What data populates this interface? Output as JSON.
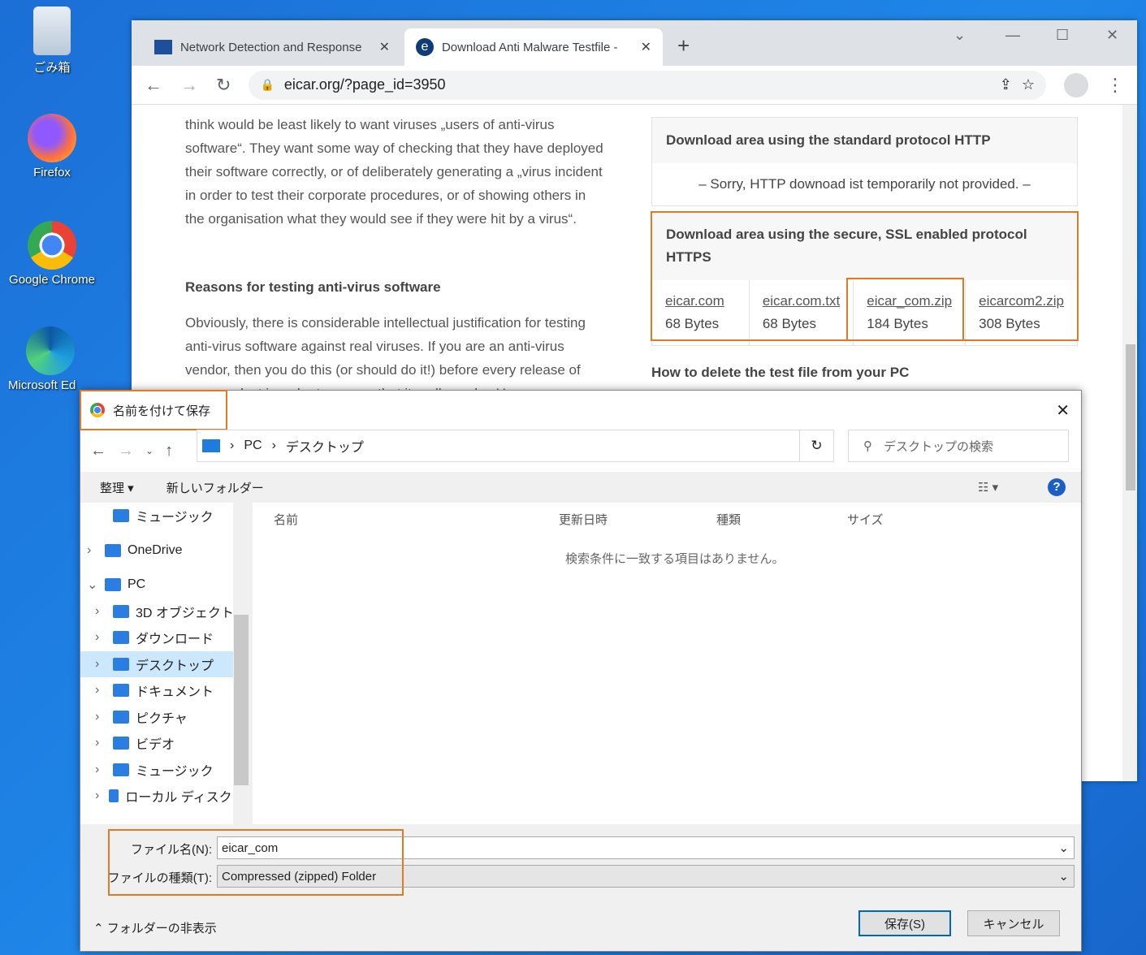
{
  "desktop": {
    "icons": [
      {
        "label": "ごみ箱",
        "icon": "recycle-bin-icon"
      },
      {
        "label": "Firefox",
        "icon": "firefox-icon"
      },
      {
        "label": "Google Chrome",
        "icon": "chrome-icon"
      },
      {
        "label": "Microsoft Ed",
        "icon": "edge-icon"
      }
    ]
  },
  "browser": {
    "tabs": [
      {
        "title": "Network Detection and Response",
        "icon": "vmw-icon"
      },
      {
        "title": "Download Anti Malware Testfile -",
        "icon": "eicar-icon"
      }
    ],
    "new_tab": "+",
    "url": "eicar.org/?page_id=3950",
    "article": {
      "para1": "think would be least likely to want viruses „users of anti-virus software“. They want some way of checking that they have deployed their software correctly, or of deliberately generating a „virus incident in order to test their corporate procedures, or of showing others in the organisation what they would see if they were hit by a virus“.",
      "heading": "Reasons for testing anti-virus software",
      "para2": "Obviously, there is considerable intellectual justification for testing anti-virus software against real viruses. If you are an anti-virus vendor, then you do this (or should do it!) before every release of your product in order to ensure that it really works. However, you"
    },
    "http_box": {
      "title": "Download area using the standard protocol HTTP",
      "message": "– Sorry, HTTP downoad ist temporarily not provided. –"
    },
    "https_box": {
      "title": "Download area using the secure, SSL enabled protocol HTTPS",
      "files": [
        {
          "name": "eicar.com",
          "size": "68 Bytes"
        },
        {
          "name": "eicar.com.txt",
          "size": "68 Bytes"
        },
        {
          "name": "eicar_com.zip",
          "size": "184 Bytes"
        },
        {
          "name": "eicarcom2.zip",
          "size": "308 Bytes"
        }
      ]
    },
    "delete_heading": "How to delete the test file from your PC"
  },
  "dialog": {
    "title": "名前を付けて保存",
    "breadcrumb": [
      "PC",
      "デスクトップ"
    ],
    "search_placeholder": "デスクトップの検索",
    "organize": "整理 ▾",
    "new_folder": "新しいフォルダー",
    "tree": [
      {
        "label": "ミュージック",
        "icon": "music-icon",
        "indent": 1
      },
      {
        "label": "OneDrive",
        "icon": "onedrive-icon",
        "indent": 0
      },
      {
        "label": "PC",
        "icon": "pc-icon",
        "indent": 0
      },
      {
        "label": "3D オブジェクト",
        "icon": "3d-objects-icon",
        "indent": 1
      },
      {
        "label": "ダウンロード",
        "icon": "download-icon",
        "indent": 1
      },
      {
        "label": "デスクトップ",
        "icon": "desktop-icon",
        "indent": 1
      },
      {
        "label": "ドキュメント",
        "icon": "document-icon",
        "indent": 1
      },
      {
        "label": "ピクチャ",
        "icon": "pictures-icon",
        "indent": 1
      },
      {
        "label": "ビデオ",
        "icon": "video-icon",
        "indent": 1
      },
      {
        "label": "ミュージック",
        "icon": "music-icon",
        "indent": 1
      },
      {
        "label": "ローカル ディスク (C",
        "icon": "disk-icon",
        "indent": 1
      }
    ],
    "columns": [
      "名前",
      "更新日時",
      "種類",
      "サイズ"
    ],
    "empty_message": "検索条件に一致する項目はありません。",
    "filename_label": "ファイル名(N):",
    "filename_value": "eicar_com",
    "filetype_label": "ファイルの種類(T):",
    "filetype_value": "Compressed (zipped) Folder",
    "hide_folders": "フォルダーの非表示",
    "save": "保存(S)",
    "cancel": "キャンセル"
  },
  "colors": {
    "highlight": "#e07b24",
    "accent": "#0067c0"
  }
}
